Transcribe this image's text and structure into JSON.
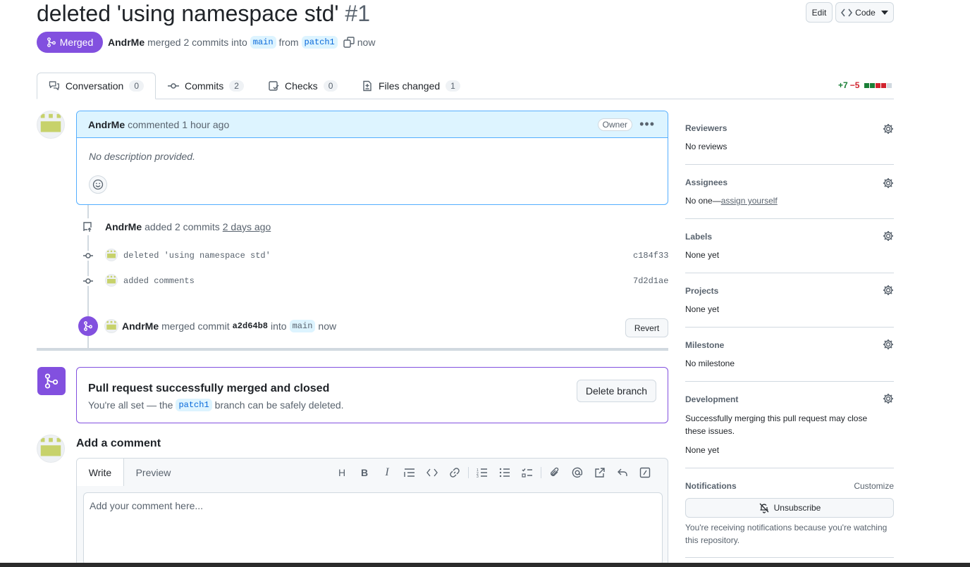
{
  "header": {
    "title": "deleted 'using namespace std'",
    "number": "#1",
    "edit_label": "Edit",
    "code_label": "Code",
    "status": "Merged",
    "author": "AndrMe",
    "merge_text": "merged 2 commits into",
    "base_branch": "main",
    "from_text": "from",
    "head_branch": "patch1",
    "time": "now"
  },
  "tabs": [
    {
      "label": "Conversation",
      "count": "0"
    },
    {
      "label": "Commits",
      "count": "2"
    },
    {
      "label": "Checks",
      "count": "0"
    },
    {
      "label": "Files changed",
      "count": "1"
    }
  ],
  "diffstat": {
    "additions": "+7",
    "deletions": "−5"
  },
  "comment": {
    "author": "AndrMe",
    "action": "commented",
    "time": "1 hour ago",
    "role": "Owner",
    "body": "No description provided."
  },
  "commits_event": {
    "author": "AndrMe",
    "text": "added 2 commits",
    "time": "2 days ago",
    "commits": [
      {
        "message": "deleted 'using namespace std'",
        "sha": "c184f33"
      },
      {
        "message": "added comments",
        "sha": "7d2d1ae"
      }
    ]
  },
  "merge_event": {
    "author": "AndrMe",
    "text": "merged commit",
    "sha": "a2d64b8",
    "into": "into",
    "branch": "main",
    "time": "now",
    "revert_label": "Revert"
  },
  "merged_box": {
    "title": "Pull request successfully merged and closed",
    "sub_before": "You're all set — the",
    "branch": "patch1",
    "sub_after": "branch can be safely deleted.",
    "delete_label": "Delete branch"
  },
  "add_comment": {
    "title": "Add a comment",
    "write_tab": "Write",
    "preview_tab": "Preview",
    "placeholder": "Add your comment here..."
  },
  "sidebar": {
    "reviewers": {
      "title": "Reviewers",
      "value": "No reviews"
    },
    "assignees": {
      "title": "Assignees",
      "value_prefix": "No one—",
      "link": "assign yourself"
    },
    "labels": {
      "title": "Labels",
      "value": "None yet"
    },
    "projects": {
      "title": "Projects",
      "value": "None yet"
    },
    "milestone": {
      "title": "Milestone",
      "value": "No milestone"
    },
    "development": {
      "title": "Development",
      "desc": "Successfully merging this pull request may close these issues.",
      "value": "None yet"
    },
    "notifications": {
      "title": "Notifications",
      "customize": "Customize",
      "unsubscribe": "Unsubscribe",
      "note": "You're receiving notifications because you're watching this repository."
    }
  },
  "colors": {
    "merged": "#8250df",
    "accent": "#0969da",
    "add": "#1a7f37",
    "del": "#d1242f"
  }
}
